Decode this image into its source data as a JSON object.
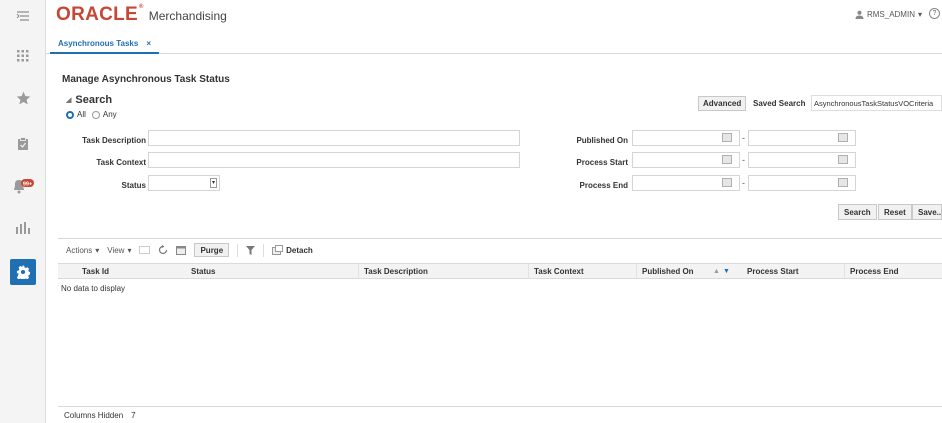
{
  "header": {
    "brand": "ORACLE",
    "brand_mark": "®",
    "app_name": "Merchandising",
    "user": "RMS_ADMIN",
    "user_caret": "▾",
    "help": "?",
    "nav_icon": "tasklist-menu-icon"
  },
  "rail": {
    "items": [
      {
        "icon": "grid-apps-icon"
      },
      {
        "icon": "star-favorites-icon"
      },
      {
        "icon": "clipboard-tasks-icon"
      },
      {
        "icon": "bell-notifications-icon",
        "badge": "99+"
      },
      {
        "icon": "bar-chart-reports-icon"
      },
      {
        "icon": "gear-settings-icon",
        "active": true
      }
    ]
  },
  "tabs": [
    {
      "label": "Asynchronous Tasks",
      "close": "×"
    }
  ],
  "page": {
    "title": "Manage Asynchronous Task Status",
    "search_title": "Search",
    "match_all": "All",
    "match_any": "Any",
    "advanced": "Advanced",
    "saved_search_label": "Saved Search",
    "saved_search_value": "AsynchronousTaskStatusVOCriteria"
  },
  "fields": {
    "task_description": "Task Description",
    "task_context": "Task Context",
    "status": "Status",
    "published_on": "Published On",
    "process_start": "Process Start",
    "process_end": "Process End",
    "range_dash": "-"
  },
  "actions": {
    "search": "Search",
    "reset": "Reset",
    "save": "Save..."
  },
  "toolbar": {
    "actions": "Actions",
    "view": "View",
    "caret": "▾",
    "purge": "Purge",
    "detach": "Detach"
  },
  "table": {
    "columns": [
      "Task Id",
      "Status",
      "Task Description",
      "Task Context",
      "Published On",
      "Process Start",
      "Process End"
    ],
    "sort_asc": "▲",
    "sort_desc": "▼",
    "empty": "No data to display",
    "columns_hidden_label": "Columns Hidden",
    "columns_hidden_count": "7"
  },
  "colors": {
    "accent": "#1f6fb3",
    "brand": "#c74634"
  }
}
